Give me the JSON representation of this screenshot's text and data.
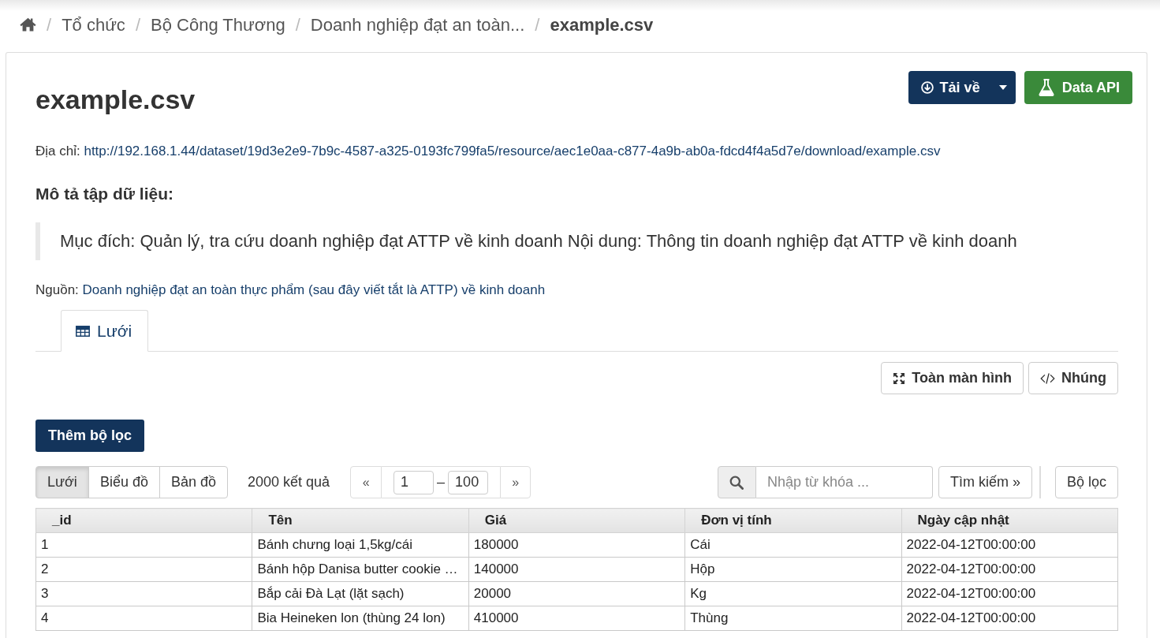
{
  "breadcrumb": [
    {
      "separator": "/",
      "label": "Tổ chức",
      "current": false
    },
    {
      "separator": "/",
      "label": "Bộ Công Thương",
      "current": false
    },
    {
      "separator": "/",
      "label": "Doanh nghiệp đạt an toàn...",
      "current": false
    },
    {
      "separator": "/",
      "label": "example.csv",
      "current": true
    }
  ],
  "title": "example.csv",
  "actions": [
    {
      "kind": "download",
      "label": "Tải về"
    },
    {
      "kind": "api",
      "label": "Data API"
    }
  ],
  "address": {
    "label": "Địa chỉ:",
    "url": "http://192.168.1.44/dataset/19d3e2e9-7b9c-4587-a325-0193fc799fa5/resource/aec1e0aa-c877-4a9b-ab0a-fdcd4f4a5d7e/download/example.csv"
  },
  "description": {
    "heading": "Mô tả tập dữ liệu:",
    "text": "Mục đích: Quản lý, tra cứu doanh nghiệp đạt ATTP về kinh doanh Nội dung: Thông tin doanh nghiệp đạt ATTP về kinh doanh"
  },
  "source": {
    "label": "Nguồn:",
    "link": "Doanh nghiệp đạt an toàn thực phẩm (sau đây viết tắt là ATTP) về kinh doanh"
  },
  "view_tabs": [
    {
      "label": "Lưới",
      "selected": true
    }
  ],
  "view_actions": [
    {
      "kind": "fullscreen",
      "label": "Toàn màn hình"
    },
    {
      "kind": "embed",
      "label": "Nhúng"
    }
  ],
  "add_filter": "Thêm bộ lọc",
  "toolbar": {
    "modes": [
      {
        "label": "Lưới",
        "selected": true
      },
      {
        "label": "Biểu đồ",
        "selected": false
      },
      {
        "label": "Bản đồ",
        "selected": false
      }
    ],
    "result_count": "2000 kết quả",
    "pager": {
      "prev": "«",
      "from": "1",
      "separator": "–",
      "to": "100",
      "next": "»"
    },
    "search": {
      "placeholder": "Nhập từ khóa ...",
      "button": "Tìm kiếm »"
    },
    "filter_button": "Bộ lọc"
  },
  "table": {
    "columns": [
      "_id",
      "Tên",
      "Giá",
      "Đơn vị tính",
      "Ngày cập nhật"
    ],
    "rows": [
      [
        "1",
        "Bánh chưng loại 1,5kg/cái",
        "180000",
        "Cái",
        "2022-04-12T00:00:00"
      ],
      [
        "2",
        "Bánh hộp Danisa butter cookie …",
        "140000",
        "Hộp",
        "2022-04-12T00:00:00"
      ],
      [
        "3",
        "Bắp cải Đà Lạt (lặt sạch)",
        "20000",
        "Kg",
        "2022-04-12T00:00:00"
      ],
      [
        "4",
        "Bia Heineken lon (thùng 24 lon)",
        "410000",
        "Thùng",
        "2022-04-12T00:00:00"
      ]
    ]
  }
}
